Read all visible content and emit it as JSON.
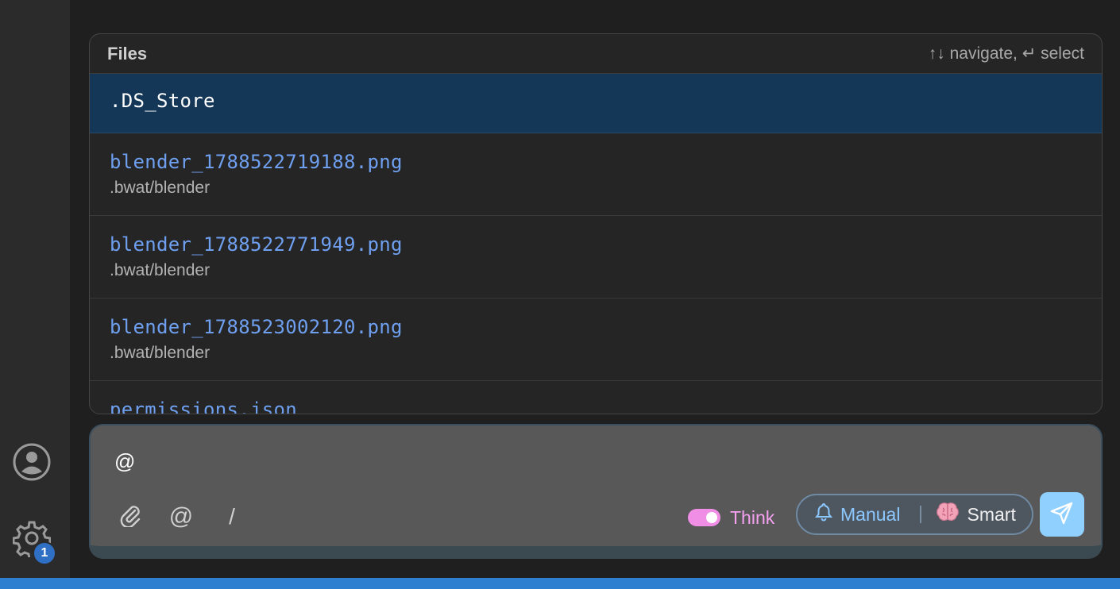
{
  "popup": {
    "title": "Files",
    "hint": "↑↓ navigate, ↵ select",
    "items": [
      {
        "name": ".DS_Store",
        "path": ""
      },
      {
        "name": "blender_1788522719188.png",
        "path": ".bwat/blender"
      },
      {
        "name": "blender_1788522771949.png",
        "path": ".bwat/blender"
      },
      {
        "name": "blender_1788523002120.png",
        "path": ".bwat/blender"
      },
      {
        "name": "permissions.json",
        "path": ""
      }
    ]
  },
  "composer": {
    "input_value": "@",
    "mention_symbol": "@",
    "slash_symbol": "/",
    "think_label": "Think",
    "manual_label": "Manual",
    "smart_label": "Smart"
  },
  "activity": {
    "settings_badge": "1"
  },
  "icons": {
    "account": "account-icon",
    "settings": "gear-icon",
    "attach": "paperclip-icon",
    "manual": "bell-icon",
    "smart": "brain-icon",
    "send": "send-icon"
  },
  "colors": {
    "selected_row": "#143758",
    "file_link": "#6fa0f0",
    "think_toggle": "#f08ee6",
    "manual_accent": "#8cc8ff",
    "send_button": "#8fd0ff",
    "status_bar": "#2f7fd0",
    "badge": "#2f6fc4"
  }
}
